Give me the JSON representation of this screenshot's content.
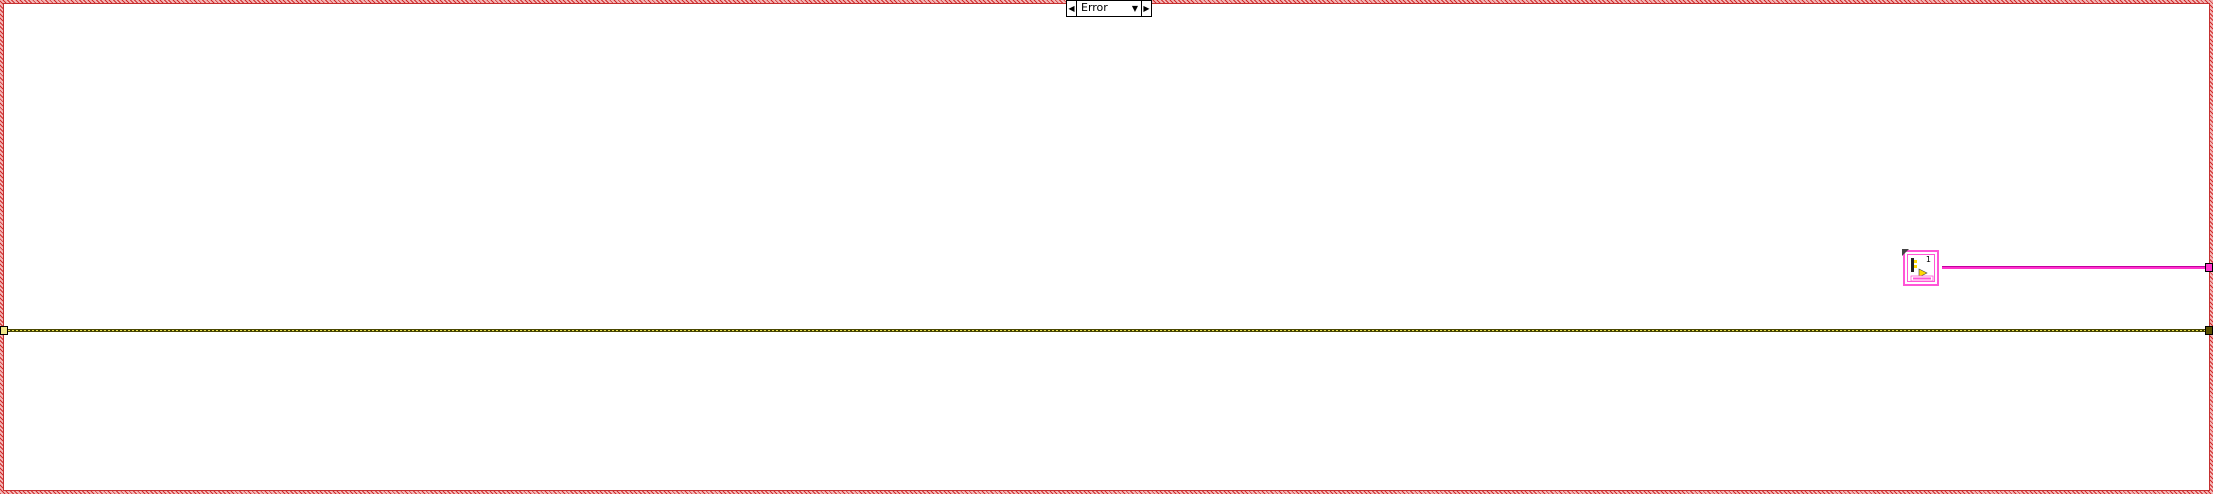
{
  "case_structure": {
    "selector": {
      "selected_case": "Error",
      "prev_glyph": "◀",
      "next_glyph": "▶",
      "dropdown_glyph": "▼"
    }
  },
  "wires": {
    "error_cluster_color": "#e8e050",
    "string_wire_color": "#ff33cc"
  },
  "node": {
    "icon": "format-into-string-icon",
    "top_digit": "1"
  },
  "colors": {
    "frame": "#d22a2a",
    "background": "#ffffff"
  }
}
